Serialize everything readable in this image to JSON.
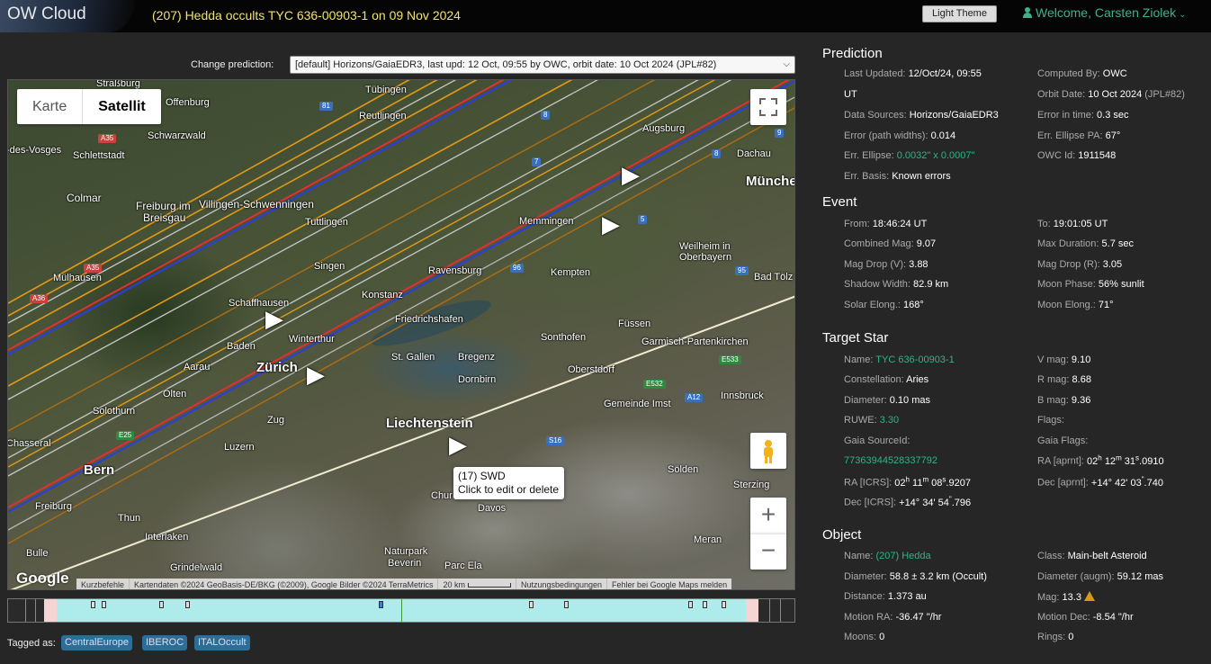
{
  "app": {
    "logo": "OW Cloud",
    "title": "(207) Hedda occults TYC 636-00903-1 on 09 Nov 2024",
    "theme_button": "Light Theme",
    "welcome": "Welcome, Carsten Ziolek"
  },
  "prediction_selector": {
    "label": "Change prediction:",
    "value": "[default] Horizons/GaiaEDR3, last upd: 12 Oct, 09:55 by OWC, orbit date: 10 Oct 2024 (JPL#82)"
  },
  "map": {
    "type_buttons": [
      "Karte",
      "Satellit"
    ],
    "selected_type": "Satellit",
    "tooltip": {
      "line1": "(17) SWD",
      "line2": "Click to edit or delete"
    },
    "google": "Google",
    "attribution": [
      "Kurzbefehle",
      "Kartendaten ©2024 GeoBasis-DE/BKG (©2009), Google Bilder ©2024 TerraMetrics",
      "20 km",
      "Nutzungsbedingungen",
      "Fehler bei Google Maps melden"
    ],
    "cities": [
      {
        "name": "Straßburg",
        "big": false
      },
      {
        "name": "Tübingen",
        "big": false
      },
      {
        "name": "Reutlingen",
        "big": false
      },
      {
        "name": "Offenburg",
        "big": false
      },
      {
        "name": "Schwarzwald",
        "big": false
      },
      {
        "name": "-des-Vosges",
        "big": false
      },
      {
        "name": "Schlettstadt",
        "big": false
      },
      {
        "name": "Augsburg",
        "big": false
      },
      {
        "name": "Dachau",
        "big": false
      },
      {
        "name": "Colmar",
        "big": false
      },
      {
        "name": "Freiburg im",
        "big": false
      },
      {
        "name": "Breisgau",
        "big": false
      },
      {
        "name": "Villingen-Schwenningen",
        "big": false
      },
      {
        "name": "Tuttlingen",
        "big": false
      },
      {
        "name": "Memmingen",
        "big": false
      },
      {
        "name": "München",
        "big": true
      },
      {
        "name": "Mülhausen",
        "big": false
      },
      {
        "name": "Singen",
        "big": false
      },
      {
        "name": "Ravensburg",
        "big": false
      },
      {
        "name": "Kempten",
        "big": false
      },
      {
        "name": "Weilheim in",
        "big": false
      },
      {
        "name": "Oberbayern",
        "big": false
      },
      {
        "name": "Bad Tölz",
        "big": false
      },
      {
        "name": "Schaffhausen",
        "big": false
      },
      {
        "name": "Konstanz",
        "big": false
      },
      {
        "name": "Friedrichshafen",
        "big": false
      },
      {
        "name": "Füssen",
        "big": false
      },
      {
        "name": "Baden",
        "big": false
      },
      {
        "name": "Winterthur",
        "big": false
      },
      {
        "name": "Sonthofen",
        "big": false
      },
      {
        "name": "Garmisch-Partenkirchen",
        "big": false
      },
      {
        "name": "Zürich",
        "big": true
      },
      {
        "name": "St. Gallen",
        "big": false
      },
      {
        "name": "Bregenz",
        "big": false
      },
      {
        "name": "Aarau",
        "big": false
      },
      {
        "name": "Oberstdorf",
        "big": false
      },
      {
        "name": "Dornbirn",
        "big": false
      },
      {
        "name": "Olten",
        "big": false
      },
      {
        "name": "Innsbruck",
        "big": false
      },
      {
        "name": "Gemeinde Imst",
        "big": false
      },
      {
        "name": "Solothurn",
        "big": false
      },
      {
        "name": "Liechtenstein",
        "big": true
      },
      {
        "name": "Zug",
        "big": false
      },
      {
        "name": "Luzern",
        "big": false
      },
      {
        "name": "Bern",
        "big": true
      },
      {
        "name": "Sölden",
        "big": false
      },
      {
        "name": "Chur",
        "big": false
      },
      {
        "name": "Davos",
        "big": false
      },
      {
        "name": "Sterzing",
        "big": false
      },
      {
        "name": "Freiburg",
        "big": false
      },
      {
        "name": "Thun",
        "big": false
      },
      {
        "name": "Interlaken",
        "big": false
      },
      {
        "name": "Meran",
        "big": false
      },
      {
        "name": "Grindelwald",
        "big": false
      },
      {
        "name": "Bulle",
        "big": false
      },
      {
        "name": "Naturpark",
        "big": false
      },
      {
        "name": "Beverin",
        "big": false
      },
      {
        "name": "Parc Ela",
        "big": false
      },
      {
        "name": "Chasseral",
        "big": false
      }
    ],
    "roads": [
      "81",
      "8",
      "A35",
      "9",
      "7",
      "8",
      "5",
      "A35",
      "96",
      "95",
      "A36",
      "E533",
      "E532",
      "A12",
      "E25",
      "S16"
    ]
  },
  "tagged": {
    "label": "Tagged as:",
    "tags": [
      "CentralEurope",
      "IBEROC",
      "ITALOccult"
    ]
  },
  "panel": {
    "prediction": {
      "title": "Prediction",
      "last_updated_label": "Last Updated:",
      "last_updated": "12/Oct/24, 09:55",
      "last_updated_2": "UT",
      "computed_by_label": "Computed By:",
      "computed_by": "OWC",
      "orbit_date_label": "Orbit Date:",
      "orbit_date": "10 Oct 2024",
      "orbit_jpl": "(JPL#82)",
      "data_sources_label": "Data Sources:",
      "data_sources": "Horizons/GaiaEDR3",
      "error_in_time_label": "Error in time:",
      "error_in_time": "0.3 sec",
      "error_path_label": "Error (path widths):",
      "error_path": "0.014",
      "err_ellipse_pa_label": "Err. Ellipse PA:",
      "err_ellipse_pa": "67°",
      "err_ellipse_label": "Err. Ellipse:",
      "err_ellipse": "0.0032\" x 0.0007\"",
      "owc_id_label": "OWC Id:",
      "owc_id": "1911548",
      "err_basis_label": "Err. Basis:",
      "err_basis": "Known errors"
    },
    "event": {
      "title": "Event",
      "from_label": "From:",
      "from": "18:46:24 UT",
      "to_label": "To:",
      "to": "19:01:05 UT",
      "combined_mag_label": "Combined Mag:",
      "combined_mag": "9.07",
      "max_duration_label": "Max Duration:",
      "max_duration": "5.7 sec",
      "mag_drop_v_label": "Mag Drop (V):",
      "mag_drop_v": "3.88",
      "mag_drop_r_label": "Mag Drop (R):",
      "mag_drop_r": "3.05",
      "shadow_width_label": "Shadow Width:",
      "shadow_width": "82.9 km",
      "moon_phase_label": "Moon Phase:",
      "moon_phase": "56% sunlit",
      "solar_elong_label": "Solar Elong.:",
      "solar_elong": "168°",
      "moon_elong_label": "Moon Elong.:",
      "moon_elong": "71°"
    },
    "target_star": {
      "title": "Target Star",
      "name_label": "Name:",
      "name": "TYC 636-00903-1",
      "v_mag_label": "V mag:",
      "v_mag": "9.10",
      "constellation_label": "Constellation:",
      "constellation": "Aries",
      "r_mag_label": "R mag:",
      "r_mag": "8.68",
      "diameter_label": "Diameter:",
      "diameter": "0.10 mas",
      "b_mag_label": "B mag:",
      "b_mag": "9.36",
      "ruwe_label": "RUWE:",
      "ruwe": "3.30",
      "flags_label": "Flags:",
      "gaia_sourceid_label": "Gaia SourceId:",
      "gaia_sourceid": "77363944528337792",
      "gaia_flags_label": "Gaia Flags:",
      "ra_icrs_label": "RA [ICRS]:",
      "ra_icrs": {
        "h": "02",
        "m": "11",
        "s": "08",
        "frac": ".9207"
      },
      "ra_aprnt_label": "RA [aprnt]:",
      "ra_aprnt": {
        "h": "02",
        "m": "12",
        "s": "31",
        "frac": ".0910"
      },
      "dec_icrs_label": "Dec [ICRS]:",
      "dec_icrs": {
        "d": "+14° 34",
        "m": "'",
        "s": " 54",
        "frac": ".796"
      },
      "dec_aprnt_label": "Dec [aprnt]:",
      "dec_aprnt": {
        "d": "+14° 42",
        "m": "'",
        "s": " 03",
        "frac": ".740"
      }
    },
    "object": {
      "title": "Object",
      "name_label": "Name:",
      "name": "(207) Hedda",
      "class_label": "Class:",
      "class": "Main-belt Asteroid",
      "diameter_label": "Diameter:",
      "diameter": "58.8 ± 3.2 km",
      "diameter_note": "(Occult)",
      "diameter_augm_label": "Diameter (augm):",
      "diameter_augm": "59.12 mas",
      "distance_label": "Distance:",
      "distance": "1.373 au",
      "mag_label": "Mag:",
      "mag": "13.3",
      "motion_ra_label": "Motion RA:",
      "motion_ra": "-36.47 \"/hr",
      "motion_dec_label": "Motion Dec:",
      "motion_dec": "-8.54 \"/hr",
      "moons_label": "Moons:",
      "moons": "0",
      "rings_label": "Rings:",
      "rings": "0"
    }
  }
}
